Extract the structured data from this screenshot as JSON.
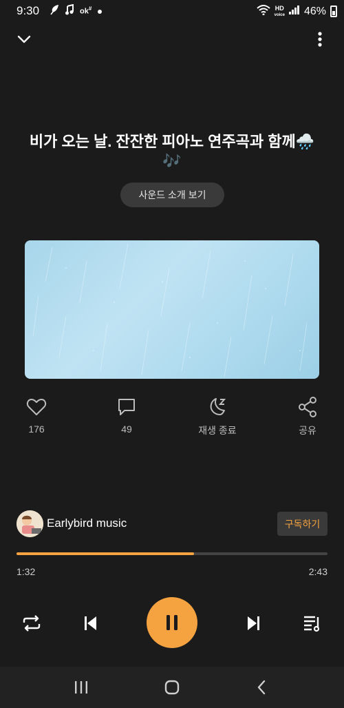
{
  "status_bar": {
    "time": "9:30",
    "left_icons": [
      "feather-icon",
      "music-note-icon",
      "ok-icon",
      "dot-icon"
    ],
    "hd_label": "HD",
    "hd_sub": "voice",
    "battery_percent": "46%"
  },
  "track": {
    "title": "비가 오는 날. 잔잔한 피아노 연주곡과 함께🌧️🎶",
    "intro_button": "사운드 소개 보기"
  },
  "actions": [
    {
      "icon": "heart-icon",
      "label": "176"
    },
    {
      "icon": "comment-icon",
      "label": "49"
    },
    {
      "icon": "sleep-timer-icon",
      "label": "재생 종료"
    },
    {
      "icon": "share-icon",
      "label": "공유"
    }
  ],
  "channel": {
    "name": "Earlybird music",
    "subscribe_label": "구독하기"
  },
  "playback": {
    "current_time": "1:32",
    "total_time": "2:43",
    "progress": 0.57
  },
  "colors": {
    "accent": "#f5a340",
    "background": "#1b1b1b"
  }
}
